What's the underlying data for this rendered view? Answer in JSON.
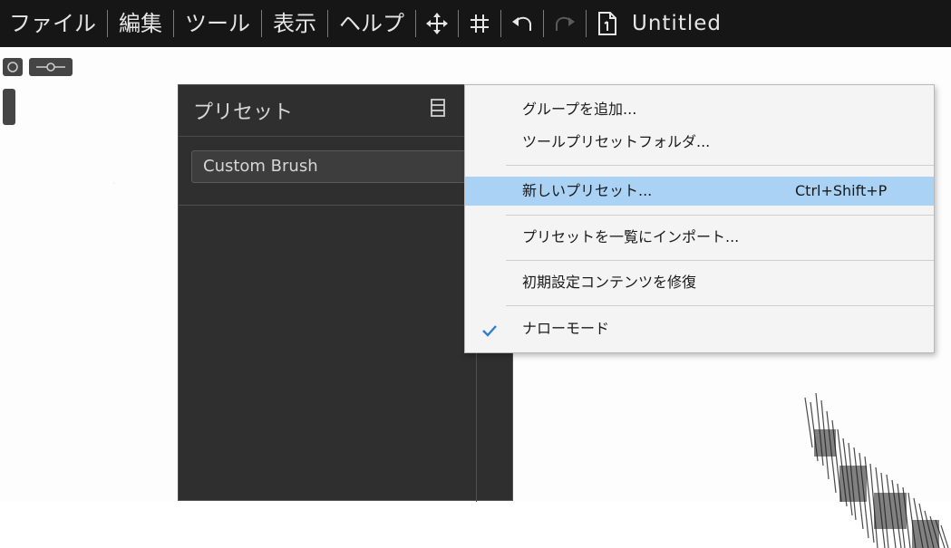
{
  "menubar": {
    "items": [
      "ファイル",
      "編集",
      "ツール",
      "表示",
      "ヘルプ"
    ],
    "doc_title": "Untitled"
  },
  "icons": {
    "move": "move-arrows-icon",
    "grid": "grid-hash-icon",
    "undo": "undo-icon",
    "redo": "redo-icon",
    "document": "document-icon"
  },
  "panel": {
    "title": "プリセット",
    "preset_value": "Custom Brush"
  },
  "context_menu": {
    "items": [
      {
        "label": "グループを追加..."
      },
      {
        "label": "ツールプリセットフォルダ..."
      },
      {
        "label": "新しいプリセット...",
        "shortcut": "Ctrl+Shift+P",
        "highlighted": true
      },
      {
        "label": "プリセットを一覧にインポート..."
      },
      {
        "label": "初期設定コンテンツを修復"
      },
      {
        "label": "ナローモード",
        "checked": true
      }
    ]
  },
  "colors": {
    "menubar_bg": "#161616",
    "panel_bg": "#2f2f2f",
    "menu_bg": "#f4f4f4",
    "highlight": "#a9d2f4",
    "check": "#2e7fd0"
  }
}
